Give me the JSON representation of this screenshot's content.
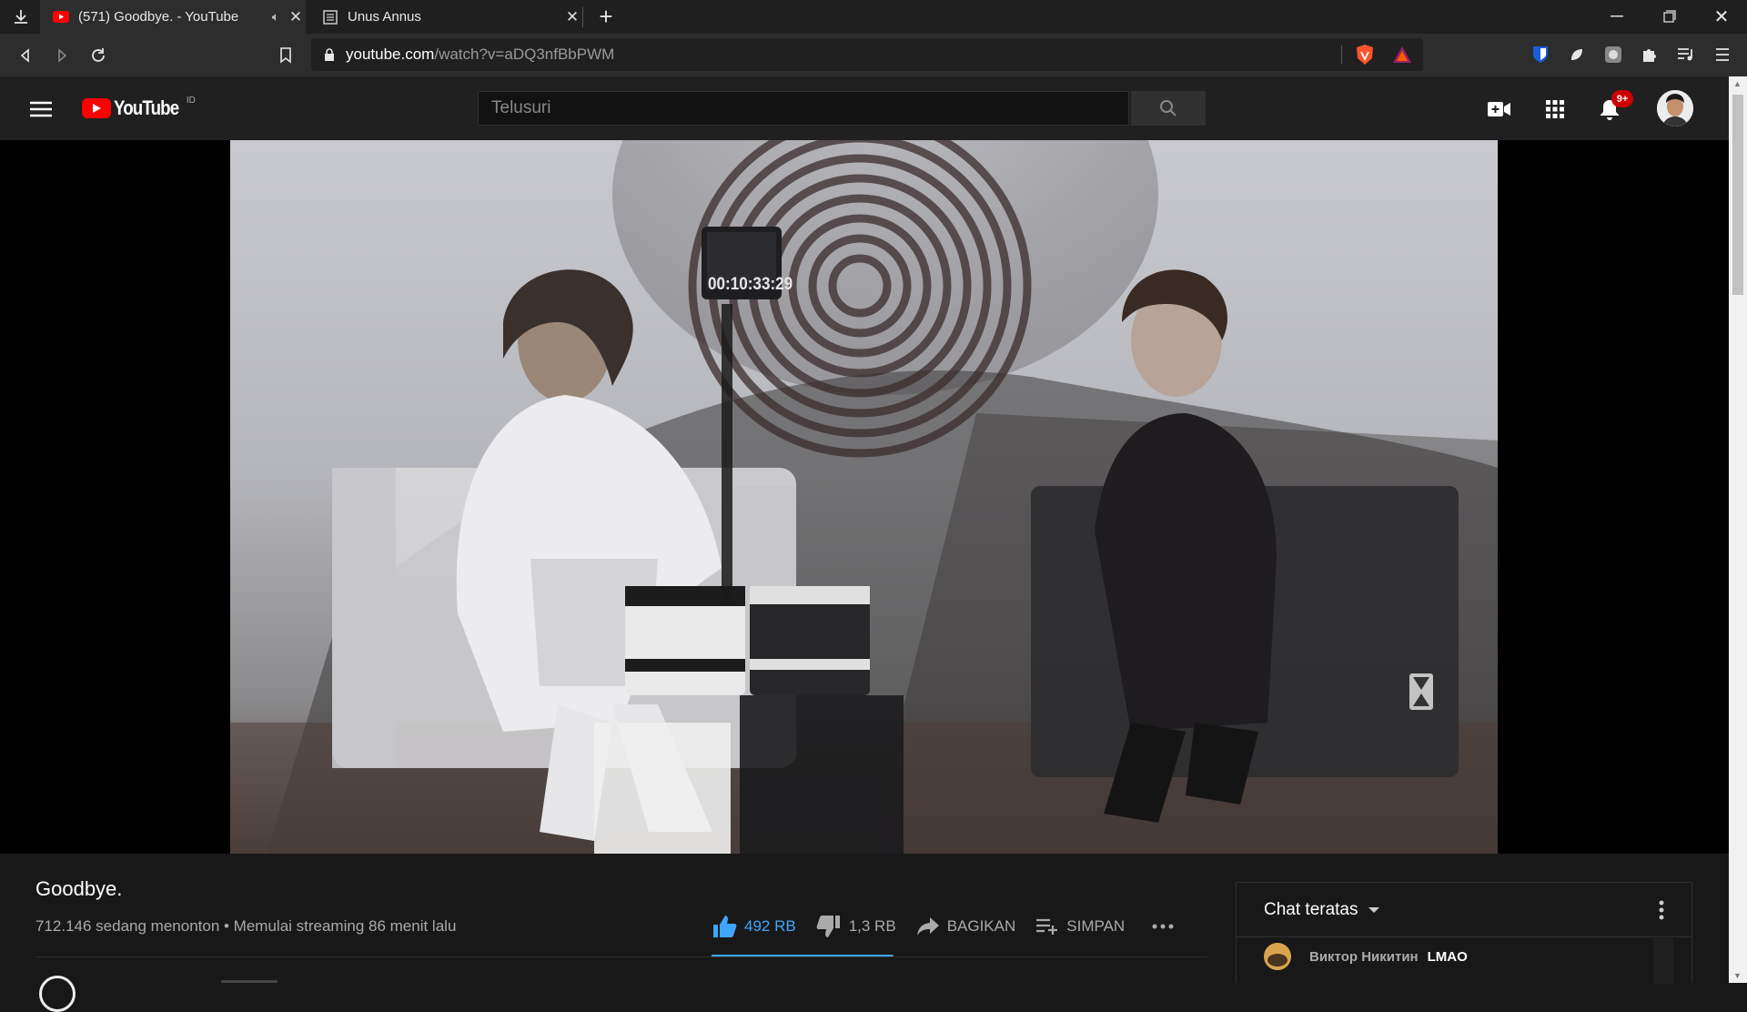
{
  "browser": {
    "tabs": [
      {
        "title": "(571) Goodbye. - YouTube",
        "active": true,
        "audio": true
      },
      {
        "title": "Unus Annus",
        "active": false
      }
    ],
    "url_host": "youtube.com",
    "url_path": "/watch?v=aDQ3nfBbPWM",
    "notification_badge": "9+"
  },
  "youtube": {
    "logo_text": "YouTube",
    "country_code": "ID",
    "search_placeholder": "Telusuri"
  },
  "video": {
    "timer_text": "00:10:33:29",
    "title": "Goodbye.",
    "meta": "712.146 sedang menonton • Memulai streaming 86 menit lalu",
    "likes": "492 RB",
    "dislikes": "1,3 RB",
    "like_ratio": 0.997,
    "share_label": "BAGIKAN",
    "save_label": "SIMPAN"
  },
  "chat": {
    "header": "Chat teratas",
    "messages": [
      {
        "author": "Виктор Никитин",
        "text": "LMAO"
      }
    ]
  },
  "colors": {
    "accent_blue": "#3ea6ff",
    "youtube_red": "#ff0000",
    "bg": "#181818"
  }
}
